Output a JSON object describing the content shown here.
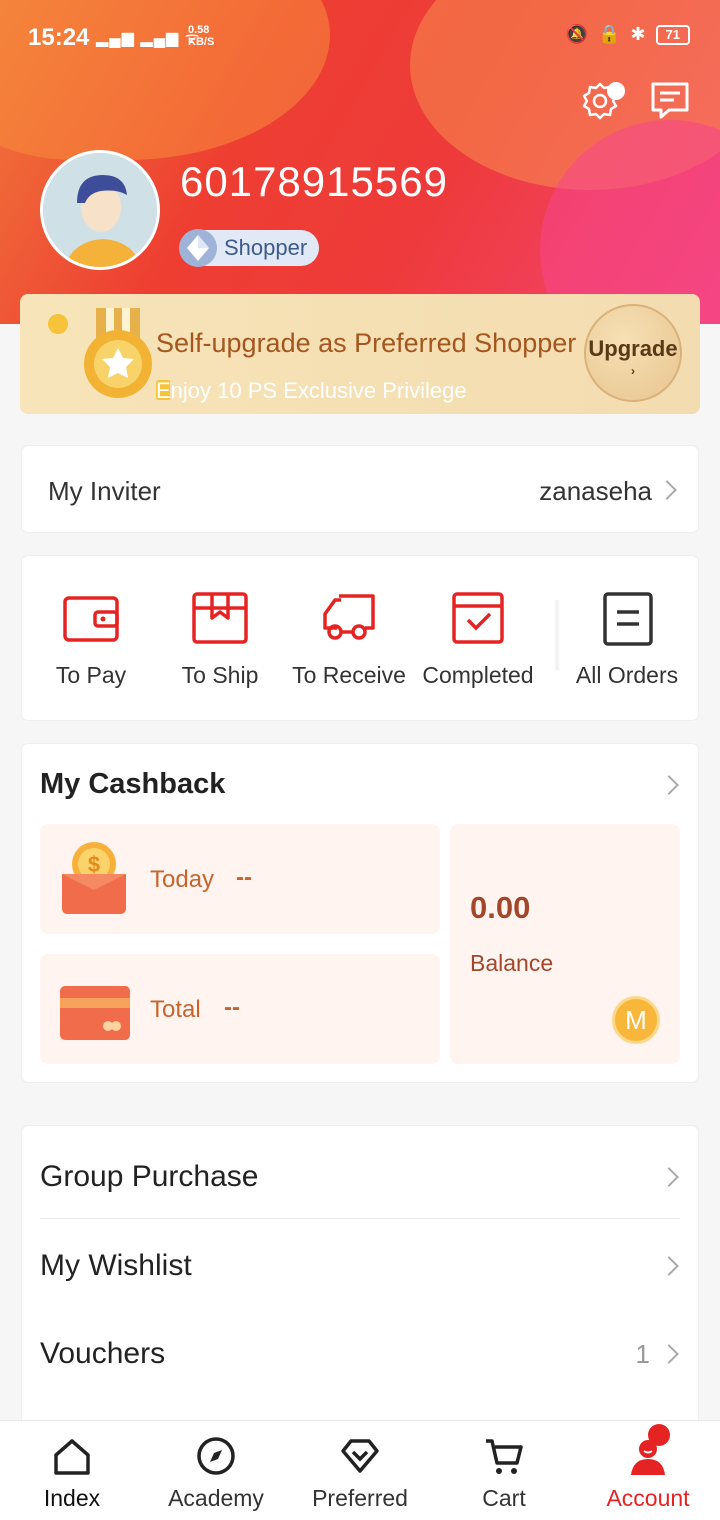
{
  "status_bar": {
    "time": "15:24",
    "speed_value": "0.58",
    "speed_unit": "KB/S",
    "battery": "71"
  },
  "profile": {
    "phone": "60178915569",
    "level": "Shopper"
  },
  "upgrade_banner": {
    "title": "Self-upgrade as Preferred Shopper",
    "subtitle": "Enjoy 10 PS Exclusive Privilege",
    "button_label": "Upgrade"
  },
  "inviter": {
    "label": "My Inviter",
    "value": "zanaseha"
  },
  "orders": [
    {
      "label": "To Pay",
      "icon": "wallet-icon"
    },
    {
      "label": "To Ship",
      "icon": "box-icon"
    },
    {
      "label": "To Receive",
      "icon": "truck-icon"
    },
    {
      "label": "Completed",
      "icon": "check-icon"
    },
    {
      "label": "All Orders",
      "icon": "list-icon"
    }
  ],
  "cashback": {
    "title": "My Cashback",
    "today_label": "Today",
    "today_value": "--",
    "total_label": "Total",
    "total_value": "--",
    "balance_value": "0.00",
    "balance_label": "Balance",
    "coin_letter": "M"
  },
  "menu": [
    {
      "label": "Group Purchase",
      "count": ""
    },
    {
      "label": "My Wishlist",
      "count": ""
    },
    {
      "label": "Vouchers",
      "count": "1"
    }
  ],
  "bottom_nav": [
    {
      "label": "Index",
      "icon": "home-icon"
    },
    {
      "label": "Academy",
      "icon": "compass-icon"
    },
    {
      "label": "Preferred",
      "icon": "diamond-icon"
    },
    {
      "label": "Cart",
      "icon": "cart-icon"
    },
    {
      "label": "Account",
      "icon": "account-icon",
      "active": true
    }
  ],
  "colors": {
    "brand_red": "#e62323",
    "header_gradient_start": "#f07a3a",
    "header_gradient_end": "#f4477a",
    "cashback_text": "#c7642b"
  }
}
